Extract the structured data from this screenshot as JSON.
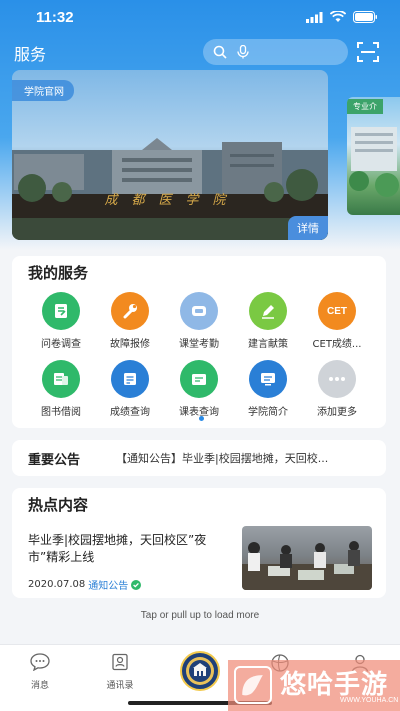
{
  "status_bar": {
    "time": "11:32"
  },
  "header": {
    "title": "服务"
  },
  "banner": {
    "tag": "学院官网",
    "sign_text": "成都医学院",
    "detail_label": "详情"
  },
  "banner2": {
    "tag": "专业介"
  },
  "services": {
    "title": "我的服务",
    "items": [
      {
        "label": "问卷调查",
        "icon": "survey-icon",
        "color": "#2fb96a"
      },
      {
        "label": "故障报修",
        "icon": "wrench-icon",
        "color": "#f28a1f"
      },
      {
        "label": "课堂考勤",
        "icon": "chat-bubble-icon",
        "color": "#8fb8e6"
      },
      {
        "label": "建言献策",
        "icon": "pencil-icon",
        "color": "#7ac943"
      },
      {
        "label": "CET成绩...",
        "icon": "cet-icon",
        "icon_text": "CET",
        "color": "#f28a1f"
      },
      {
        "label": "图书借阅",
        "icon": "book-icon",
        "color": "#2fb96a"
      },
      {
        "label": "成绩查询",
        "icon": "document-icon",
        "color": "#2a7fd6"
      },
      {
        "label": "课表查询",
        "icon": "schedule-icon",
        "color": "#2fb96a"
      },
      {
        "label": "学院简介",
        "icon": "monitor-icon",
        "color": "#2a7fd6"
      },
      {
        "label": "添加更多",
        "icon": "more-icon",
        "color": "#cfd3d8"
      }
    ]
  },
  "notice": {
    "title": "重要公告",
    "text": "【通知公告】毕业季|校园摆地摊，天回校..."
  },
  "hot": {
    "title": "热点内容",
    "headline": "毕业季|校园摆地摊，天回校区”夜市”精彩上线",
    "date": "2020.07.08",
    "category": "通知公告"
  },
  "load_more": "Tap or pull up to load more",
  "tabbar": {
    "tabs": [
      {
        "label": "消息"
      },
      {
        "label": "通讯录"
      }
    ]
  },
  "watermark": {
    "text": "悠哈手游",
    "sub": "WWW.YOUHA.CN"
  }
}
